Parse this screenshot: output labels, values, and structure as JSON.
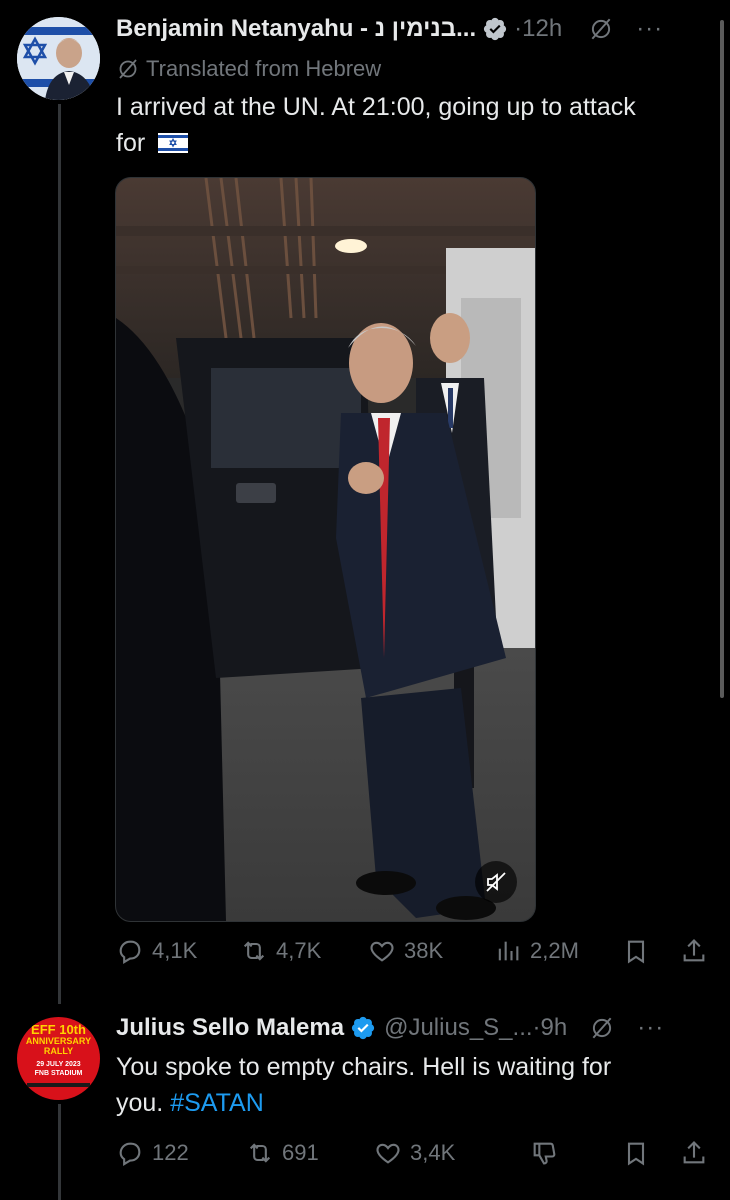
{
  "tweet1": {
    "author_name": "Benjamin Netanyahu - בנימין נ...",
    "time": "12h",
    "translated_label": "Translated from Hebrew",
    "text_line1": "I arrived at the UN. At 21:00, going up to attack",
    "text_line2": "for",
    "flag_emoji": "🇮🇱",
    "stats": {
      "replies": "4,1K",
      "reposts": "4,7K",
      "likes": "38K",
      "views": "2,2M"
    }
  },
  "tweet2": {
    "author_name": "Julius Sello Malema",
    "handle": "@Julius_S_...",
    "time": "9h",
    "text_line1": "You spoke to empty chairs. Hell is waiting for",
    "text_line2_prefix": "you.",
    "hashtag": "#SATAN",
    "avatar_text": {
      "line1": "EFF 10th",
      "line2": "ANNIVERSARY",
      "line3": "RALLY",
      "line4": "29 JULY 2023",
      "line5": "FNB STADIUM"
    },
    "stats": {
      "replies": "122",
      "reposts": "691",
      "likes": "3,4K"
    }
  },
  "colors": {
    "background": "#000000",
    "text": "#e7e9ea",
    "muted": "#71767b",
    "link": "#1d9bf0",
    "verified": "#1d9bf0"
  }
}
